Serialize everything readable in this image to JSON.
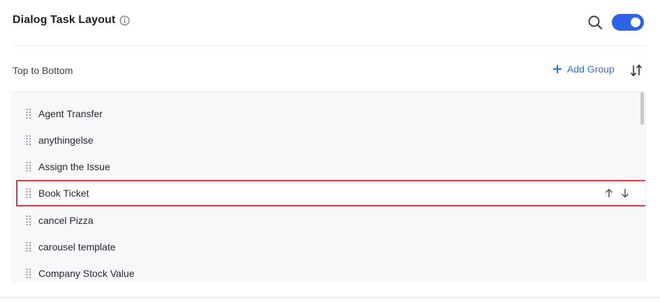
{
  "header": {
    "title": "Dialog Task Layout",
    "toggle_on": true,
    "accent_color": "#2e62e8"
  },
  "section": {
    "label": "Top to Bottom",
    "add_group_label": "Add Group"
  },
  "list": {
    "items": [
      {
        "label": "Agent Transfer"
      },
      {
        "label": "anythingelse"
      },
      {
        "label": "Assign the Issue"
      },
      {
        "label": "Book Ticket",
        "selected": true
      },
      {
        "label": "cancel Pizza"
      },
      {
        "label": "carousel template"
      },
      {
        "label": "Company Stock Value"
      }
    ]
  },
  "icons": {
    "info": "info-circle-icon",
    "search": "search-icon",
    "add": "plus-icon",
    "sort": "sort-arrows-icon",
    "drag": "drag-handle-icon",
    "move_up": "arrow-up-icon",
    "move_down": "arrow-down-icon"
  },
  "colors": {
    "highlight_border": "#e0363f",
    "link": "#2e6fd6"
  }
}
